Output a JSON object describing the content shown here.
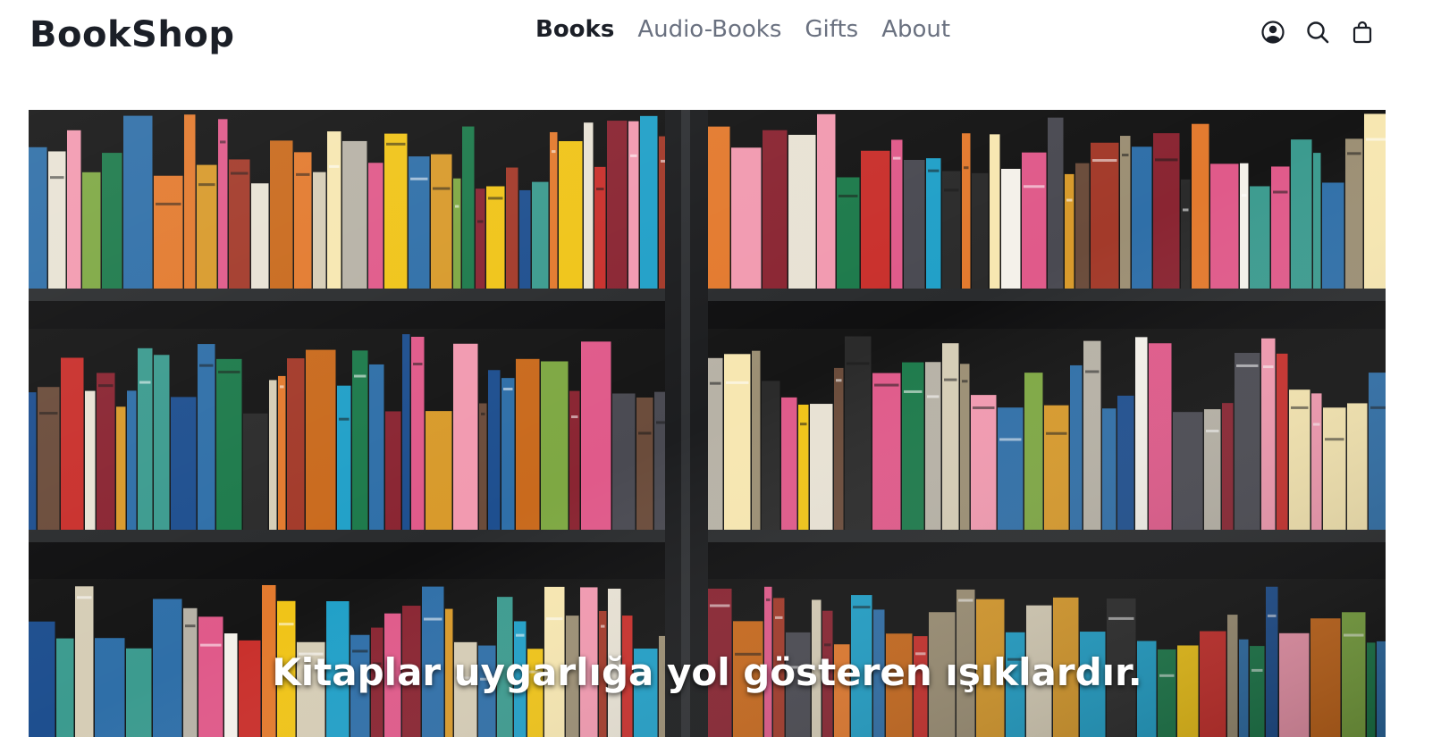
{
  "header": {
    "brand": "BookShop",
    "nav": [
      {
        "label": "Books",
        "active": true
      },
      {
        "label": "Audio-Books",
        "active": false
      },
      {
        "label": "Gifts",
        "active": false
      },
      {
        "label": "About",
        "active": false
      }
    ],
    "icons": [
      "account-icon",
      "search-icon",
      "shopping-bag-icon"
    ]
  },
  "hero": {
    "image": "bookshelf-photo",
    "caption": "Kitaplar uygarlığa yol gösteren ışıklardır."
  }
}
